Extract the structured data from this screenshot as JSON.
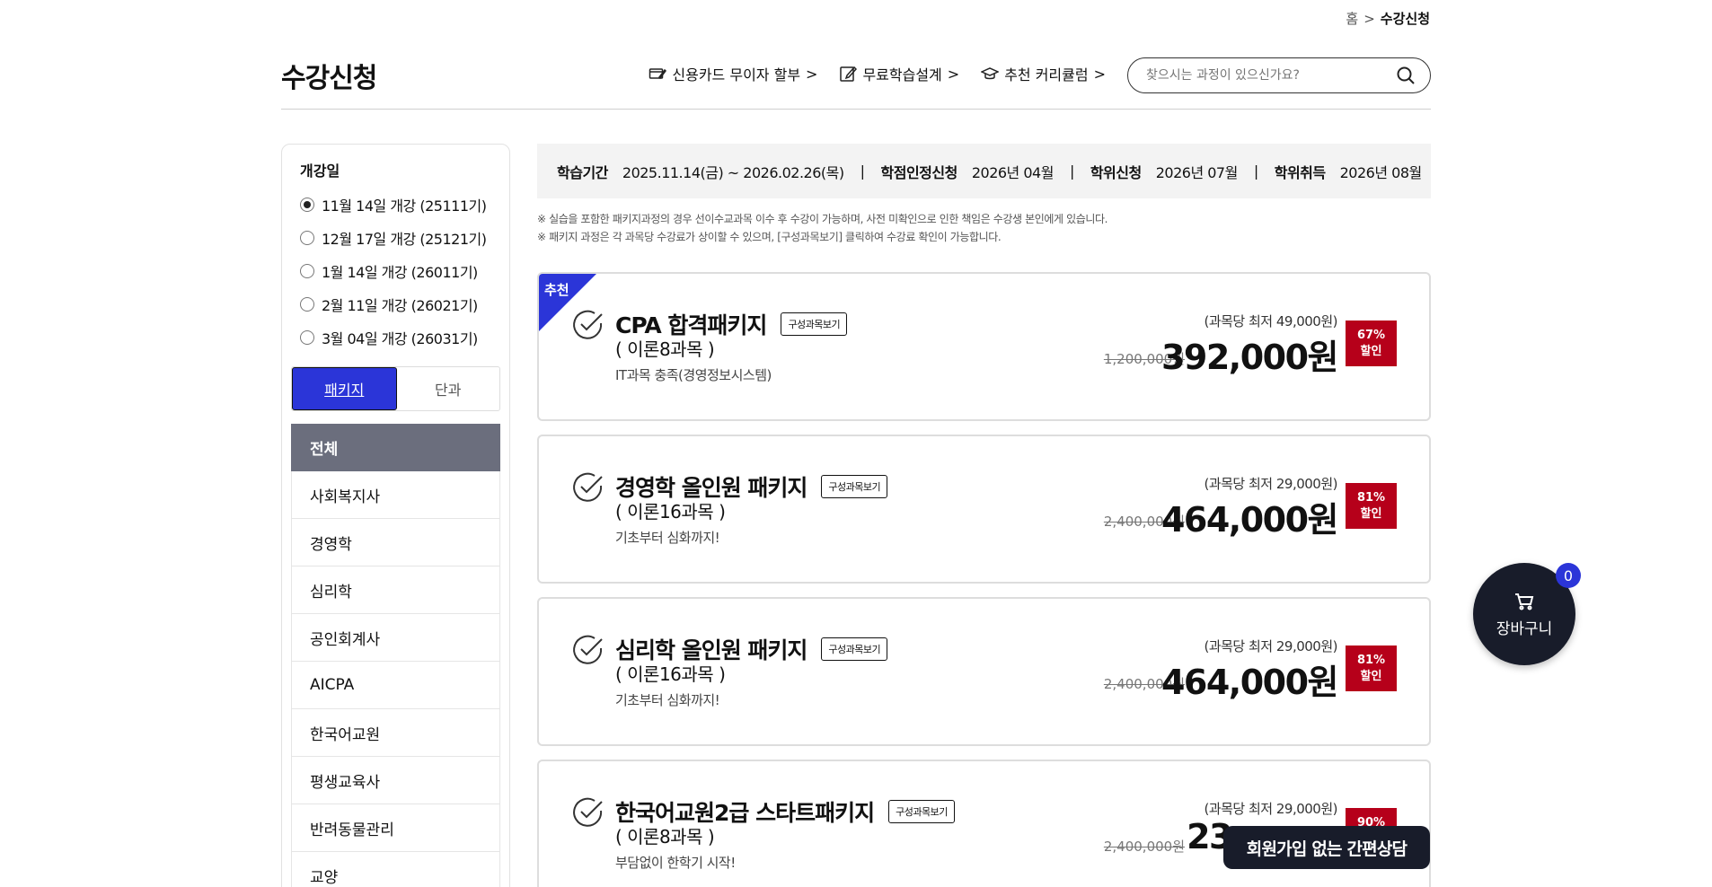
{
  "breadcrumb": {
    "home": "홈",
    "separator": ">",
    "current": "수강신청"
  },
  "page_title": "수강신청",
  "top_links": [
    {
      "label": "신용카드 무이자 할부",
      "arrow": ">",
      "icon": "card-pen-icon"
    },
    {
      "label": "무료학습설계",
      "arrow": ">",
      "icon": "edit-icon"
    },
    {
      "label": "추천 커리큘럼",
      "arrow": ">",
      "icon": "graduation-cap-icon"
    }
  ],
  "search": {
    "placeholder": "찾으시는 과정이 있으신가요?",
    "icon": "search-icon"
  },
  "sidebar": {
    "heading": "개강일",
    "dates": [
      {
        "label": "11월 14일 개강 (25111기)",
        "checked": true
      },
      {
        "label": "12월 17일 개강 (25121기)",
        "checked": false
      },
      {
        "label": "1월 14일 개강 (26011기)",
        "checked": false
      },
      {
        "label": "2월 11일 개강 (26021기)",
        "checked": false
      },
      {
        "label": "3월 04일 개강 (26031기)",
        "checked": false
      }
    ],
    "type_tabs": [
      {
        "label": "패키지",
        "active": true
      },
      {
        "label": "단과",
        "active": false
      }
    ],
    "categories": [
      {
        "label": "전체",
        "active": true
      },
      {
        "label": "사회복지사"
      },
      {
        "label": "경영학"
      },
      {
        "label": "심리학"
      },
      {
        "label": "공인회계사"
      },
      {
        "label": "AICPA"
      },
      {
        "label": "한국어교원"
      },
      {
        "label": "평생교육사"
      },
      {
        "label": "반려동물관리"
      },
      {
        "label": "교양"
      }
    ]
  },
  "info_bar": {
    "period_label": "학습기간",
    "period_value": "2025.11.14(금) ~ 2026.02.26(목)",
    "credit_label": "학점인정신청",
    "credit_value": "2026년 04월",
    "degree_apply_label": "학위신청",
    "degree_apply_value": "2026년 07월",
    "degree_get_label": "학위취득",
    "degree_get_value": "2026년 08월",
    "separator": "|"
  },
  "notes": [
    "※ 실습을 포함한 패키지과정의 경우 선이수교과목 이수 후 수강이 가능하며, 사전 미확인으로 인한 책임은 수강생 본인에게 있습니다.",
    "※ 패키지 과정은 각 과목당 수강료가 상이할 수 있으며, [구성과목보기] 클릭하여 수강료 확인이 가능합니다."
  ],
  "compose_label": "구성과목보기",
  "discount_suffix": "할인",
  "products": [
    {
      "badge": "추천",
      "title": "CPA 합격패키지",
      "subtitle": "( 이론8과목 )",
      "desc": "IT과목 충족(경영정보시스템)",
      "per_price": "(과목당 최저 49,000원)",
      "orig_price": "1,200,000원",
      "price": "392,000원",
      "discount": "67%"
    },
    {
      "badge": "",
      "title": "경영학 올인원 패키지",
      "subtitle": "( 이론16과목 )",
      "desc": "기초부터 심화까지!",
      "per_price": "(과목당 최저 29,000원)",
      "orig_price": "2,400,000원",
      "price": "464,000원",
      "discount": "81%"
    },
    {
      "badge": "",
      "title": "심리학 올인원 패키지",
      "subtitle": "( 이론16과목 )",
      "desc": "기초부터 심화까지!",
      "per_price": "(과목당 최저 29,000원)",
      "orig_price": "2,400,000원",
      "price": "464,000원",
      "discount": "81%"
    },
    {
      "badge": "",
      "title": "한국어교원2급 스타트패키지",
      "subtitle": "( 이론8과목 )",
      "desc": "부담없이 한학기 시작!",
      "per_price": "(과목당 최저 29,000원)",
      "orig_price": "2,400,000원",
      "price": "23",
      "discount": "90%"
    }
  ],
  "cart": {
    "label": "장바구니",
    "count": "0",
    "icon": "cart-icon"
  },
  "consult_button": "회원가입 없는 간편상담",
  "colors": {
    "accent": "#2b35d8",
    "discount": "#b6001a",
    "dark": "#181c2a",
    "active_category": "#6b6e7d"
  }
}
